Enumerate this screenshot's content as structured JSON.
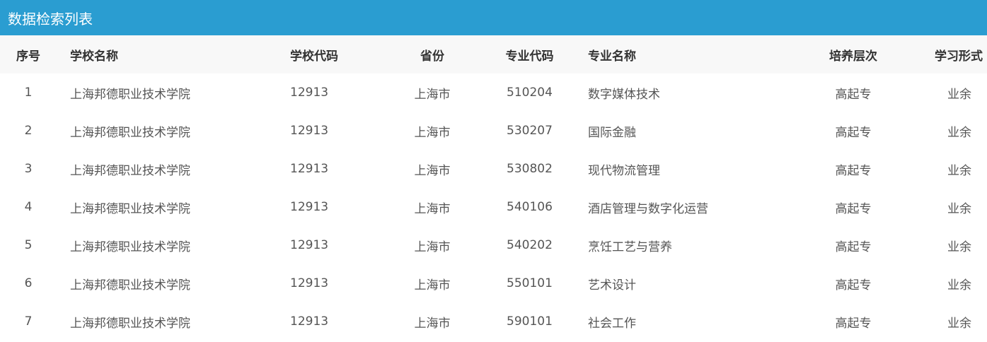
{
  "panel": {
    "title": "数据检索列表"
  },
  "table": {
    "columns": [
      "序号",
      "学校名称",
      "学校代码",
      "省份",
      "专业代码",
      "专业名称",
      "培养层次",
      "学习形式"
    ],
    "rows": [
      [
        "1",
        "上海邦德职业技术学院",
        "12913",
        "上海市",
        "510204",
        "数字媒体技术",
        "高起专",
        "业余"
      ],
      [
        "2",
        "上海邦德职业技术学院",
        "12913",
        "上海市",
        "530207",
        "国际金融",
        "高起专",
        "业余"
      ],
      [
        "3",
        "上海邦德职业技术学院",
        "12913",
        "上海市",
        "530802",
        "现代物流管理",
        "高起专",
        "业余"
      ],
      [
        "4",
        "上海邦德职业技术学院",
        "12913",
        "上海市",
        "540106",
        "酒店管理与数字化运营",
        "高起专",
        "业余"
      ],
      [
        "5",
        "上海邦德职业技术学院",
        "12913",
        "上海市",
        "540202",
        "烹饪工艺与营养",
        "高起专",
        "业余"
      ],
      [
        "6",
        "上海邦德职业技术学院",
        "12913",
        "上海市",
        "550101",
        "艺术设计",
        "高起专",
        "业余"
      ],
      [
        "7",
        "上海邦德职业技术学院",
        "12913",
        "上海市",
        "590101",
        "社会工作",
        "高起专",
        "业余"
      ]
    ]
  },
  "colors": {
    "header_bar": "#2a9dd1",
    "table_head_bg": "#f8f8f8"
  }
}
